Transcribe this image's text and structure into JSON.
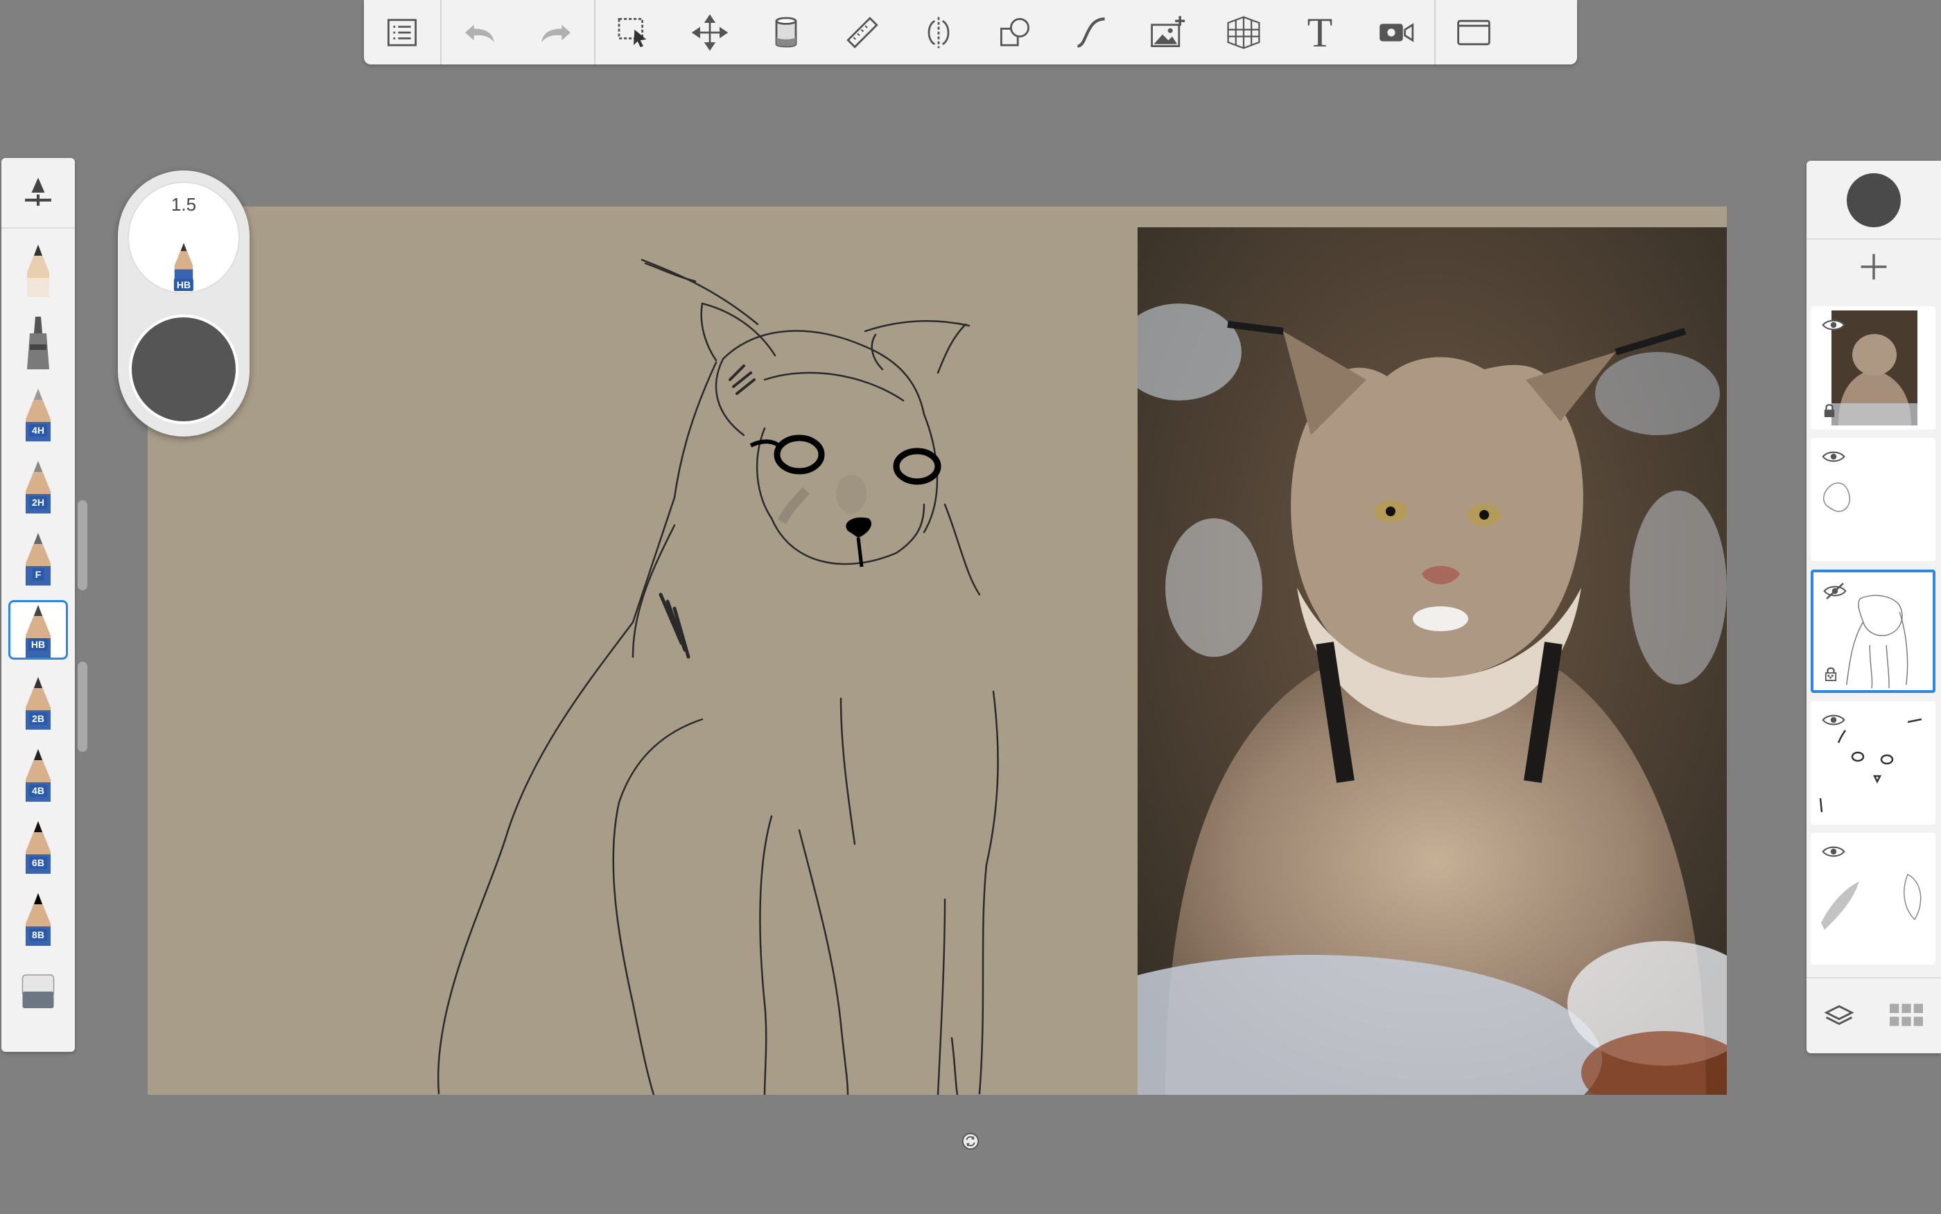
{
  "toolbar": {
    "items": [
      {
        "name": "list-icon"
      },
      {
        "name": "undo-icon"
      },
      {
        "name": "redo-icon"
      },
      {
        "name": "selection-icon"
      },
      {
        "name": "transform-icon"
      },
      {
        "name": "fill-bucket-icon"
      },
      {
        "name": "ruler-icon"
      },
      {
        "name": "symmetry-icon"
      },
      {
        "name": "shapes-icon"
      },
      {
        "name": "curve-icon"
      },
      {
        "name": "import-image-icon"
      },
      {
        "name": "perspective-icon"
      },
      {
        "name": "text-icon",
        "label": "T"
      },
      {
        "name": "time-lapse-icon"
      },
      {
        "name": "fullscreen-icon"
      }
    ]
  },
  "brush_palette": {
    "brushes": [
      {
        "name": "brush-pencil",
        "label": ""
      },
      {
        "name": "brush-marker",
        "label": ""
      },
      {
        "name": "brush-4h",
        "label": "4H"
      },
      {
        "name": "brush-2h",
        "label": "2H"
      },
      {
        "name": "brush-f",
        "label": "F"
      },
      {
        "name": "brush-hb",
        "label": "HB",
        "selected": true
      },
      {
        "name": "brush-2b",
        "label": "2B"
      },
      {
        "name": "brush-4b",
        "label": "4B"
      },
      {
        "name": "brush-6b",
        "label": "6B"
      },
      {
        "name": "brush-8b",
        "label": "8B"
      },
      {
        "name": "brush-eraser",
        "label": ""
      }
    ]
  },
  "puck": {
    "size_value": "1.5",
    "brush_label": "HB",
    "color": "#555555"
  },
  "layers_panel": {
    "current_color": "#4a4a4a",
    "layers": [
      {
        "name": "layer-photo",
        "visible": true,
        "locked": true
      },
      {
        "name": "layer-sketch-outline",
        "visible": true,
        "locked": false
      },
      {
        "name": "layer-lynx-sketch",
        "visible": false,
        "locked": true,
        "selected": true
      },
      {
        "name": "layer-eyes",
        "visible": true,
        "locked": false
      },
      {
        "name": "layer-shading",
        "visible": true,
        "locked": false
      }
    ]
  },
  "colors": {
    "app_background": "#808080",
    "canvas": "#a89d89",
    "toolbar": "#f2f2f2",
    "accent": "#2e86de"
  }
}
